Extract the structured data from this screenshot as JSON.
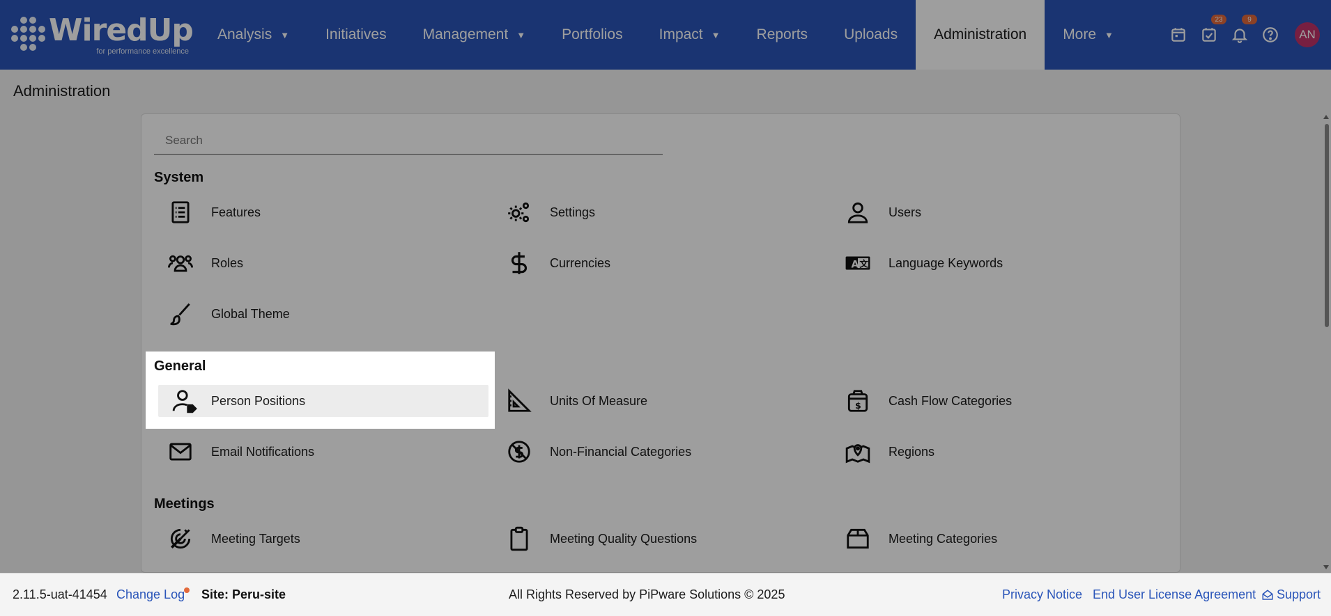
{
  "app": {
    "logo_text": "WiredUp",
    "logo_tagline": "for performance excellence"
  },
  "nav": {
    "items": [
      {
        "label": "Analysis",
        "dropdown": true
      },
      {
        "label": "Initiatives",
        "dropdown": false
      },
      {
        "label": "Management",
        "dropdown": true
      },
      {
        "label": "Portfolios",
        "dropdown": false
      },
      {
        "label": "Impact",
        "dropdown": true
      },
      {
        "label": "Reports",
        "dropdown": false
      },
      {
        "label": "Uploads",
        "dropdown": false
      },
      {
        "label": "Administration",
        "dropdown": false,
        "active": true
      },
      {
        "label": "More",
        "dropdown": true
      }
    ],
    "icons": {
      "calendar": "calendar-icon",
      "tasks": "tasks-check-icon",
      "tasks_badge": "23",
      "notifications": "bell-icon",
      "notifications_badge": "9",
      "help": "help-icon"
    },
    "avatar_initials": "AN"
  },
  "page": {
    "title": "Administration",
    "search_placeholder": "Search"
  },
  "sections": {
    "system": {
      "title": "System",
      "items": [
        "Features",
        "Settings",
        "Users",
        "Roles",
        "Currencies",
        "Language Keywords",
        "Global Theme"
      ]
    },
    "general": {
      "title": "General",
      "items": [
        "Person Positions",
        "Units Of Measure",
        "Cash Flow Categories",
        "Email Notifications",
        "Non-Financial Categories",
        "Regions"
      ]
    },
    "meetings": {
      "title": "Meetings",
      "items": [
        "Meeting Targets",
        "Meeting Quality Questions",
        "Meeting Categories"
      ]
    }
  },
  "footer": {
    "version": "2.11.5-uat-41454",
    "change_log": "Change Log",
    "site": "Site: Peru-site",
    "rights": "All Rights Reserved by PiPware Solutions © 2025",
    "privacy": "Privacy Notice",
    "eula": "End User License Agreement",
    "support": "Support"
  },
  "colors": {
    "brand": "#2a55b9",
    "badge": "#e36a3c",
    "avatar": "#c0336a"
  }
}
